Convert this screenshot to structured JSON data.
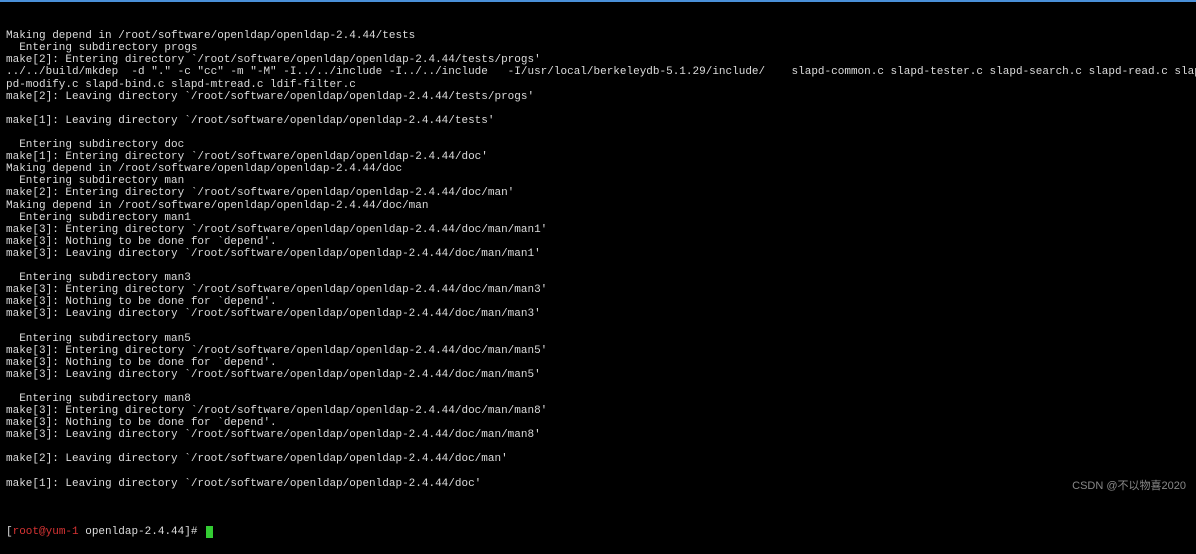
{
  "terminal": {
    "lines": [
      "Making depend in /root/software/openldap/openldap-2.4.44/tests",
      "  Entering subdirectory progs",
      "make[2]: Entering directory `/root/software/openldap/openldap-2.4.44/tests/progs'",
      "../../build/mkdep  -d \".\" -c \"cc\" -m \"-M\" -I../../include -I../../include   -I/usr/local/berkeleydb-5.1.29/include/    slapd-common.c slapd-tester.c slapd-search.c slapd-read.c slapd-addel.c slapd-modrdn.c sla",
      "pd-modify.c slapd-bind.c slapd-mtread.c ldif-filter.c",
      "make[2]: Leaving directory `/root/software/openldap/openldap-2.4.44/tests/progs'",
      "",
      "make[1]: Leaving directory `/root/software/openldap/openldap-2.4.44/tests'",
      "",
      "  Entering subdirectory doc",
      "make[1]: Entering directory `/root/software/openldap/openldap-2.4.44/doc'",
      "Making depend in /root/software/openldap/openldap-2.4.44/doc",
      "  Entering subdirectory man",
      "make[2]: Entering directory `/root/software/openldap/openldap-2.4.44/doc/man'",
      "Making depend in /root/software/openldap/openldap-2.4.44/doc/man",
      "  Entering subdirectory man1",
      "make[3]: Entering directory `/root/software/openldap/openldap-2.4.44/doc/man/man1'",
      "make[3]: Nothing to be done for `depend'.",
      "make[3]: Leaving directory `/root/software/openldap/openldap-2.4.44/doc/man/man1'",
      "",
      "  Entering subdirectory man3",
      "make[3]: Entering directory `/root/software/openldap/openldap-2.4.44/doc/man/man3'",
      "make[3]: Nothing to be done for `depend'.",
      "make[3]: Leaving directory `/root/software/openldap/openldap-2.4.44/doc/man/man3'",
      "",
      "  Entering subdirectory man5",
      "make[3]: Entering directory `/root/software/openldap/openldap-2.4.44/doc/man/man5'",
      "make[3]: Nothing to be done for `depend'.",
      "make[3]: Leaving directory `/root/software/openldap/openldap-2.4.44/doc/man/man5'",
      "",
      "  Entering subdirectory man8",
      "make[3]: Entering directory `/root/software/openldap/openldap-2.4.44/doc/man/man8'",
      "make[3]: Nothing to be done for `depend'.",
      "make[3]: Leaving directory `/root/software/openldap/openldap-2.4.44/doc/man/man8'",
      "",
      "make[2]: Leaving directory `/root/software/openldap/openldap-2.4.44/doc/man'",
      "",
      "make[1]: Leaving directory `/root/software/openldap/openldap-2.4.44/doc'",
      ""
    ]
  },
  "prompt": {
    "open_bracket": "[",
    "user": "root@yum-1",
    "space": " ",
    "dir": "openldap-2.4.44",
    "close": "]# "
  },
  "watermark": "CSDN @不以物喜2020"
}
